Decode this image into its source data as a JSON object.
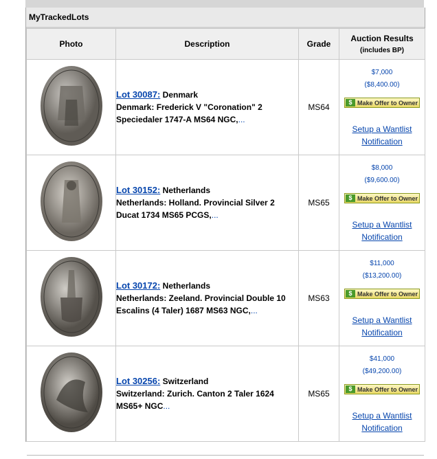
{
  "panel": {
    "title": "MyTrackedLots"
  },
  "table": {
    "headers": {
      "photo": "Photo",
      "description": "Description",
      "grade": "Grade",
      "results": "Auction Results",
      "results_sub": "(includes BP)"
    },
    "make_offer_label": "Make Offer to Owner",
    "wantlist_line1": "Setup a Wantlist",
    "wantlist_line2": "Notification",
    "rows": [
      {
        "lot": "Lot 30087:",
        "country": "Denmark",
        "description": "Denmark: Frederick V \"Coronation\" 2 Speciedaler 1747-A MS64 NGC,",
        "ellipsis": "...",
        "grade": "MS64",
        "price": "$7,000",
        "price_bp": "($8,400.00)"
      },
      {
        "lot": "Lot 30152:",
        "country": "Netherlands",
        "description": "Netherlands: Holland. Provincial Silver 2 Ducat 1734 MS65 PCGS,",
        "ellipsis": "...",
        "grade": "MS65",
        "price": "$8,000",
        "price_bp": "($9,600.00)"
      },
      {
        "lot": "Lot 30172:",
        "country": "Netherlands",
        "description": "Netherlands: Zeeland. Provincial Double 10 Escalins (4 Taler) 1687 MS63 NGC,",
        "ellipsis": "...",
        "grade": "MS63",
        "price": "$11,000",
        "price_bp": "($13,200.00)"
      },
      {
        "lot": "Lot 30256:",
        "country": "Switzerland",
        "description": "Switzerland: Zurich. Canton 2 Taler 1624 MS65+ NGC",
        "ellipsis": "...",
        "grade": "MS65",
        "price": "$41,000",
        "price_bp": "($49,200.00)"
      }
    ]
  },
  "colors": {
    "link": "#0645ad",
    "header_bg": "#efefef",
    "border": "#c9c9c9"
  },
  "icons": [
    "dollar-icon",
    "coin-photo"
  ]
}
